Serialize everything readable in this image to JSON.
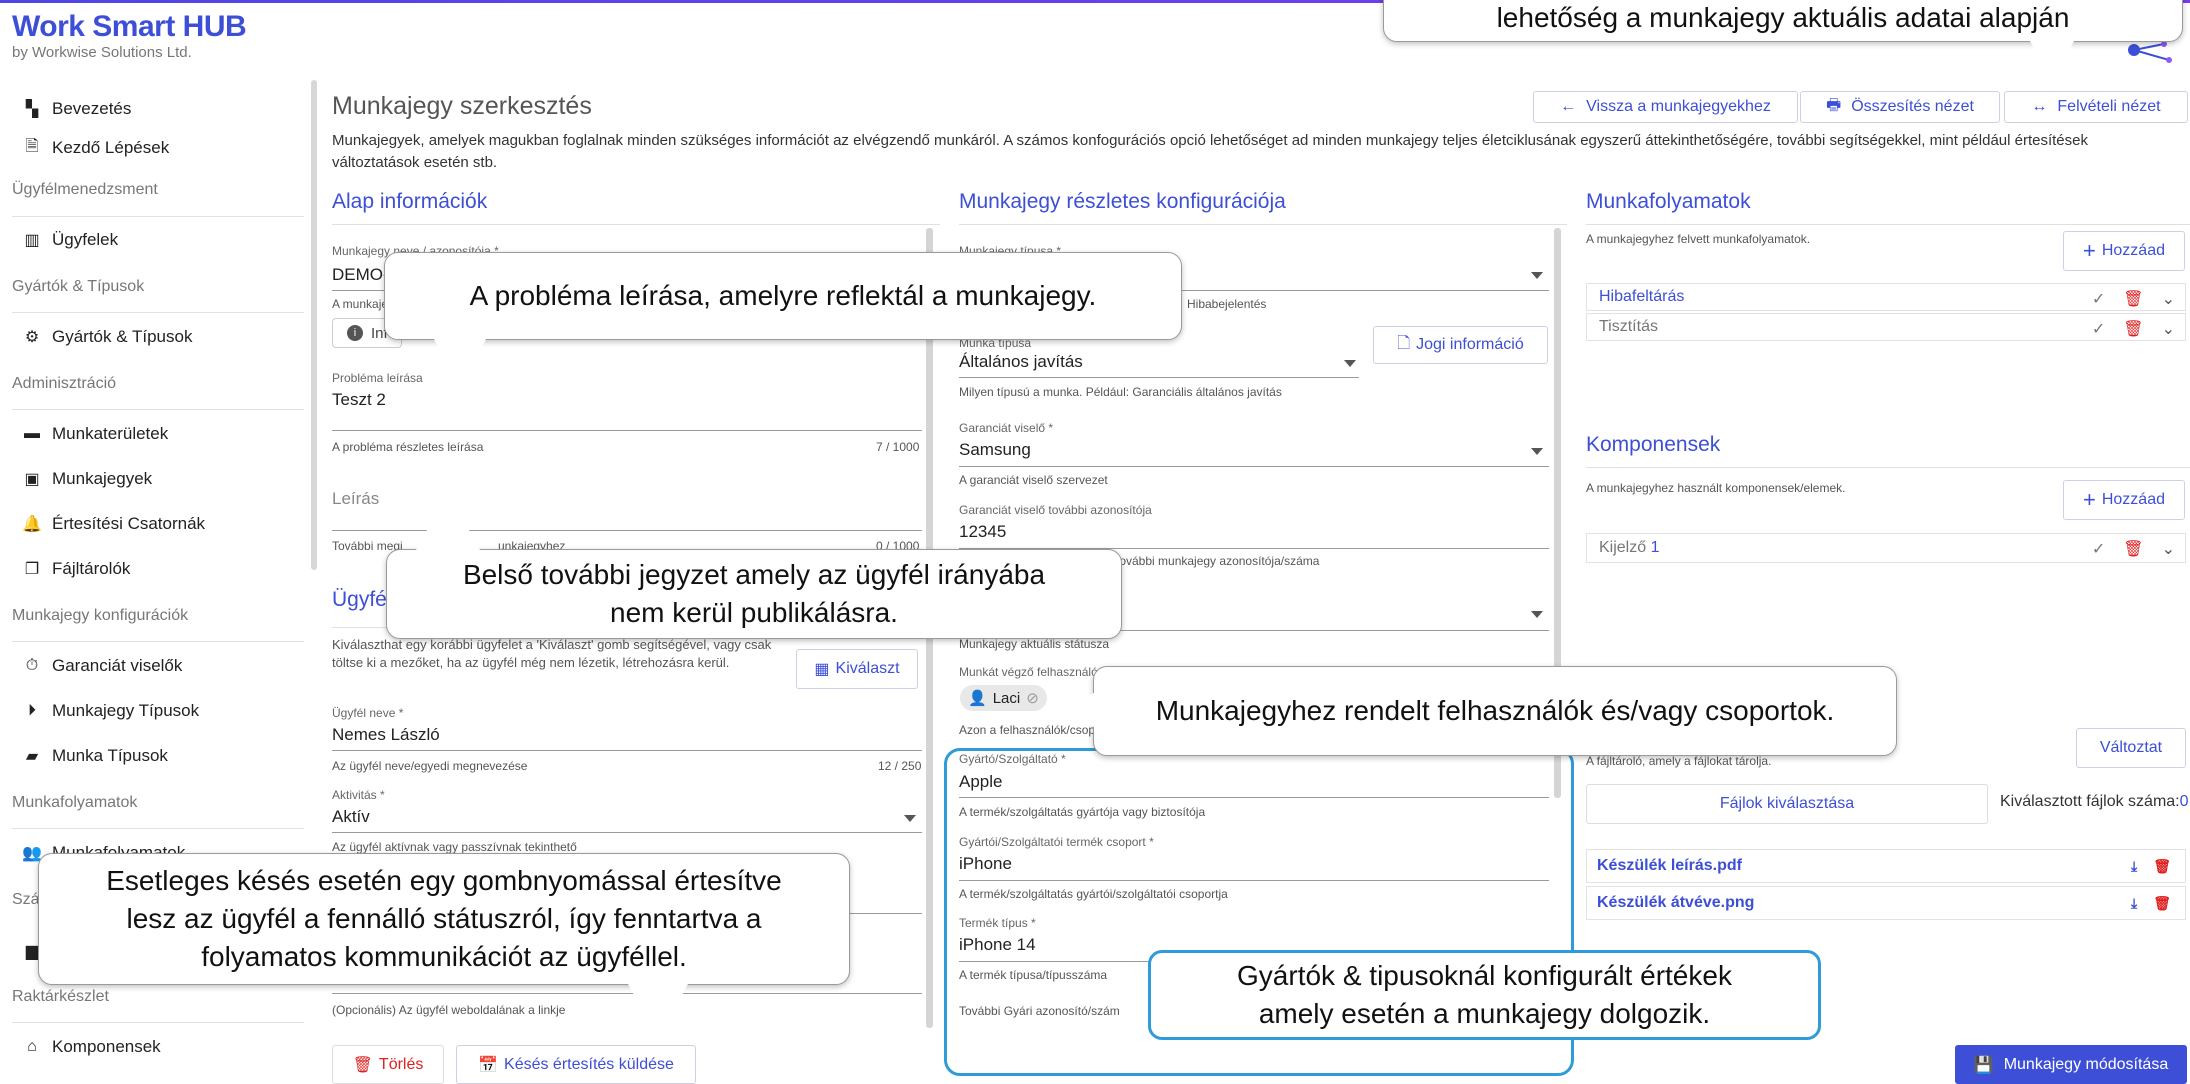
{
  "brand": {
    "title": "Work Smart HUB",
    "subtitle": "by Workwise Solutions Ltd."
  },
  "sidebar": {
    "items": [
      {
        "label": "Bevezetés",
        "icon": "dashboard-icon"
      },
      {
        "label": "Kezdő Lépések",
        "icon": "document-icon"
      },
      {
        "label": "Ügyfelek",
        "icon": "building-icon"
      },
      {
        "label": "Gyártók & Típusok",
        "icon": "gears-icon"
      },
      {
        "label": "Munkaterületek",
        "icon": "folder-icon"
      },
      {
        "label": "Munkajegyek",
        "icon": "ticket-icon"
      },
      {
        "label": "Értesítési Csatornák",
        "icon": "bell-icon"
      },
      {
        "label": "Fájltárolók",
        "icon": "files-icon"
      },
      {
        "label": "Garanciát viselők",
        "icon": "stopwatch-icon"
      },
      {
        "label": "Munkajegy Típusok",
        "icon": "tag-icon"
      },
      {
        "label": "Munka Típusok",
        "icon": "briefcase-icon"
      },
      {
        "label": "Munkafolyamatok",
        "icon": "users-icon"
      },
      {
        "label": "Komponensek",
        "icon": "warehouse-icon"
      }
    ],
    "sections": [
      "Ügyfélmenedzsment",
      "Gyártók & Típusok",
      "Adminisztráció",
      "Munkajegy konfigurációk",
      "Munkafolyamatok",
      "Szá",
      "Raktárkészlet"
    ]
  },
  "header": {
    "title": "Munkajegy szerkesztés",
    "description": "Munkajegyek, amelyek magukban foglalnak minden szükséges információt az elvégzendő munkáról. A számos konfogurációs opció lehetőséget ad minden munkajegy teljes életciklusának egyszerű áttekinthetőségére, további segítségekkel, mint például értesítések változtatások esetén stb.",
    "buttons": {
      "back": "Vissza a munkajegyekhez",
      "summary": "Összesítés nézet",
      "intake": "Felvételi nézet"
    }
  },
  "basic": {
    "title": "Alap információk",
    "name_label": "Munkajegy neve / azonosítója *",
    "name_value": "DEMO-",
    "name_help": "A munkaje",
    "info_chip": "Inf",
    "problem_label": "Probléma leírása",
    "problem_value": "Teszt 2",
    "problem_help": "A probléma részletes leírása",
    "problem_count": "7 / 1000",
    "desc_placeholder": "Leírás",
    "desc_help": "További megj",
    "desc_help2": "unkajegyhez",
    "desc_count": "0 / 1000",
    "client_title": "Ügyfé",
    "client_text": "Kiválaszthat egy korábbi ügyfelet a 'Kiválaszt' gomb segítségével, vagy csak töltse ki a mezőket, ha az ügyfél még nem lézetik, létrehozásra kerül.",
    "select_btn": "Kiválaszt",
    "client_name_label": "Ügyfél neve *",
    "client_name_value": "Nemes László",
    "client_name_help": "Az ügyfél neve/egyedi megnevezése",
    "client_name_count": "12 / 250",
    "activity_label": "Aktivitás *",
    "activity_value": "Aktív",
    "activity_help": "Az ügyfél aktívnak vagy passzívnak tekinthető",
    "website_help": "(Opcionális) Az ügyfél weboldalának a linkje",
    "delete_btn": "Törlés",
    "delay_btn": "Késés értesítés küldése"
  },
  "config": {
    "title": "Munkajegy részletes konfigurációja",
    "type_label": "Munkajegy típusa *",
    "type_help": "Hibabejelentés",
    "worktype_label": "Munka típusa",
    "worktype_value": "Általános javítás",
    "worktype_help": "Milyen típusú a munka. Például: Garanciális általános javítás",
    "legal_btn": "Jogi információ",
    "warranty_label": "Garanciát viselő *",
    "warranty_value": "Samsung",
    "warranty_help": "A garanciát viselő szervezet",
    "warranty_id_label": "Garanciát viselő további azonosítója",
    "warranty_id_value": "12345",
    "warranty_id_help": "további munkajegy azonosítója/száma",
    "status_help": "Munkajegy aktuális státusza",
    "workers_label": "Munkát végző felhasználó",
    "worker_chip": "Laci",
    "workers_help": "Azon a felhasználók/csop",
    "maker_label": "Gyártó/Szolgáltató *",
    "maker_value": "Apple",
    "maker_help": "A termék/szolgáltatás gyártója vagy biztosítója",
    "group_label": "Gyártói/Szolgáltatói termék csoport *",
    "group_value": "iPhone",
    "group_help": "A termék/szolgáltatás gyártói/szolgáltatói csoportja",
    "product_label": "Termék típus *",
    "product_value": "iPhone 14",
    "product_help": "A termék típusa/típusszáma",
    "serial_label": "További Gyári azonosító/szám"
  },
  "workflow": {
    "title": "Munkafolyamatok",
    "help": "A munkajegyhez felvett munkafolyamatok.",
    "add_btn": "Hozzáad",
    "rows": [
      "Hibafeltárás",
      "Tisztítás"
    ],
    "components_title": "Komponensek",
    "components_help": "A munkajegyhez használt komponensek/elemek.",
    "components_add": "Hozzáad",
    "component_rows": [
      {
        "name": "Kijelző",
        "qty": "1"
      }
    ],
    "storage_help": "A fájltároló, amely a fájlokat tárolja.",
    "change_btn": "Változtat",
    "choose_files_btn": "Fájlok kiválasztása",
    "selected_count_label": "Kiválasztott fájlok száma:",
    "selected_count": "0",
    "files": [
      "Készülék leírás.pdf",
      "Készülék átvéve.png"
    ],
    "save_btn": "Munkajegy módosítása"
  },
  "callouts": {
    "top_right": "lehetőség a munkajegy aktuális adatai alapján",
    "problem": "A probléma leírása, amelyre reflektál a munkajegy.",
    "note_line1": "Belső további jegyzet amely az ügyfél irányába",
    "note_line2": "nem kerül publikálásra.",
    "users": "Munkajegyhez rendelt felhasználók és/vagy csoportok.",
    "delay_line1": "Esetleges késés esetén egy gombnyomással értesítve",
    "delay_line2": "lesz az ügyfél a fennálló státuszról, így fenntartva a",
    "delay_line3": "folyamatos kommunikációt az ügyféllel.",
    "makers_line1": "Gyártók & tipusoknál konfigurált értékek",
    "makers_line2": "amely esetén a munkajegy dolgozik."
  },
  "colors": {
    "accent": "#3d4fd6",
    "danger": "#e02020",
    "callout_blue": "#2f9bd8"
  }
}
